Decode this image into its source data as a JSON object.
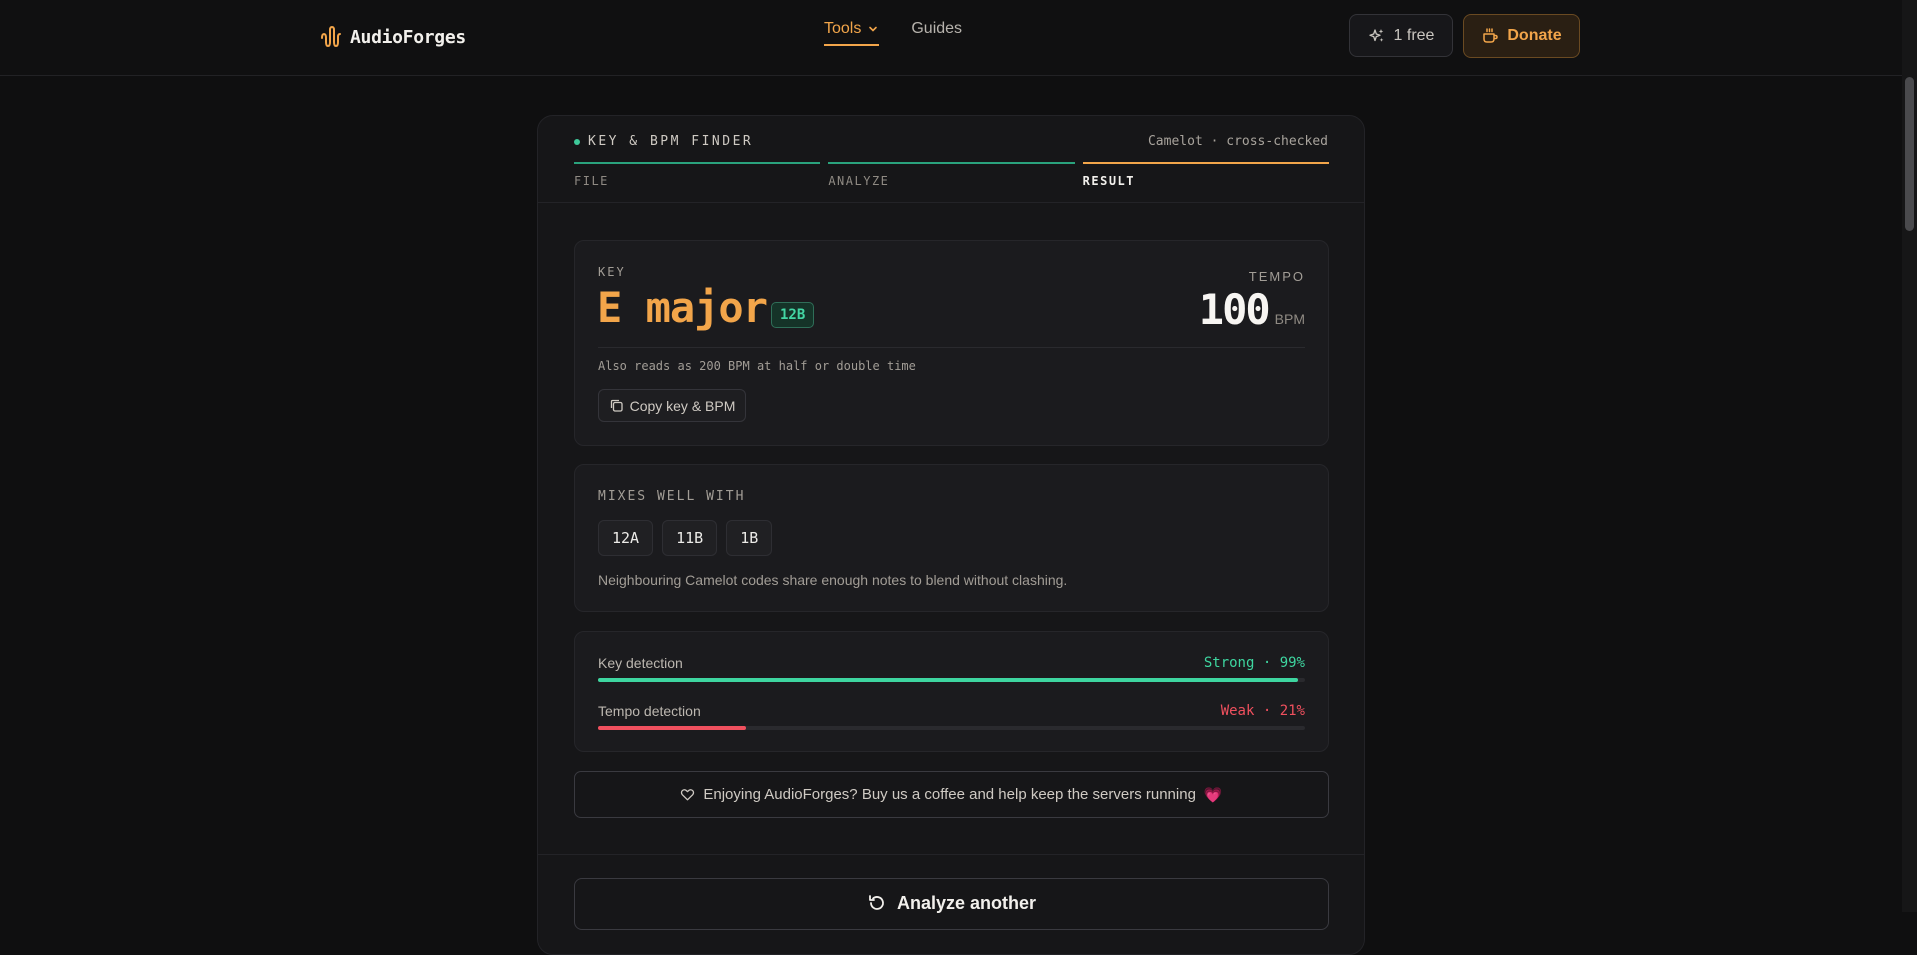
{
  "nav": {
    "brand": "AudioForges",
    "tools_label": "Tools",
    "guides_label": "Guides",
    "free_label": "1 free",
    "donate_label": "Donate"
  },
  "tool": {
    "title": "KEY & BPM FINDER",
    "note": "Camelot · cross-checked",
    "steps": [
      {
        "label": "FILE",
        "state": "done"
      },
      {
        "label": "ANALYZE",
        "state": "done"
      },
      {
        "label": "RESULT",
        "state": "active"
      }
    ]
  },
  "result": {
    "key_label": "KEY",
    "key": "E major",
    "camelot": "12B",
    "tempo_label": "TEMPO",
    "tempo": "100",
    "tempo_unit": "BPM",
    "alt_note": "Also reads as 200 BPM at half or double time",
    "copy_label": "Copy key & BPM"
  },
  "mixes": {
    "label": "MIXES WELL WITH",
    "codes": [
      "12A",
      "11B",
      "1B"
    ],
    "description": "Neighbouring Camelot codes share enough notes to blend without clashing."
  },
  "confidence": [
    {
      "name": "Key detection",
      "value_text": "Strong · 99%",
      "percent": 99,
      "color": "#3ed6a0"
    },
    {
      "name": "Tempo detection",
      "value_text": "Weak · 21%",
      "percent": 21,
      "color": "#f0505e"
    }
  ],
  "support": {
    "text": "Enjoying AudioForges? Buy us a coffee and help keep the servers running",
    "emoji": "💗"
  },
  "actions": {
    "analyze_another": "Analyze another"
  },
  "colors": {
    "accent": "#f2a54a",
    "success": "#3ec99a",
    "danger": "#f0505e"
  }
}
